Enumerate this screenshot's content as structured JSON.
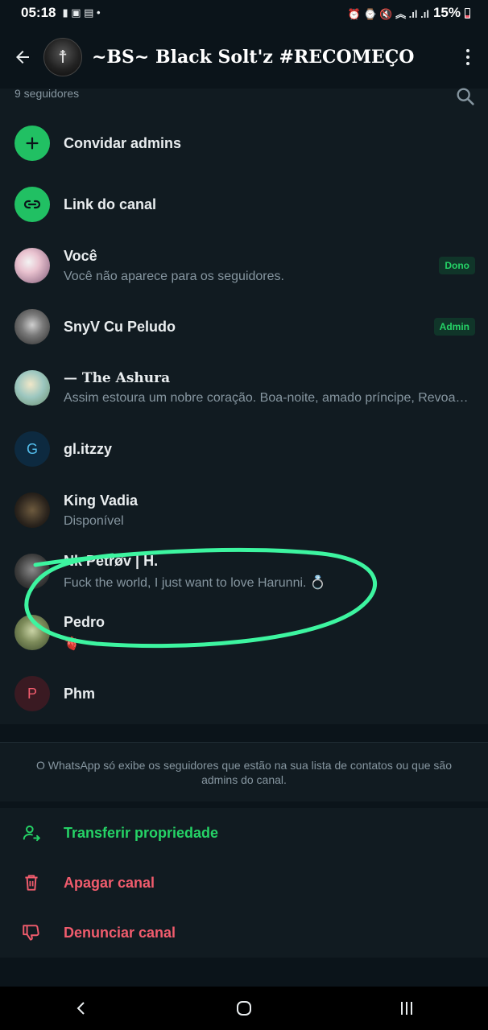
{
  "status_bar": {
    "time": "05:18",
    "battery": "15%"
  },
  "header": {
    "title": "~BS~ Black Solt'z #RECOMEÇO",
    "avatar_glyph": "☨"
  },
  "followers": {
    "count_label": "9 seguidores"
  },
  "actions_top": [
    {
      "label": "Convidar admins",
      "icon": "plus-icon"
    },
    {
      "label": "Link do canal",
      "icon": "link-icon"
    }
  ],
  "members": [
    {
      "name": "Você",
      "status": "Você não aparece para os seguidores.",
      "badge": "Dono",
      "avatar_color": "#c9a7b4"
    },
    {
      "name": "SnyV Cu Peludo",
      "status": "",
      "badge": "Admin",
      "avatar_color": "#8a8a8a"
    },
    {
      "name": "— The Ashura",
      "status": "Assim estoura um nobre coração. Boa-noite, amado príncipe, Revoadas de anjos te embalem o sono.",
      "badge": "",
      "avatar_color": "#c9b88a"
    },
    {
      "name": "gl.itzzy",
      "status": "",
      "badge": "",
      "avatar_letter": "G",
      "avatar_color": "#0d2a40",
      "letter_color": "#53bdeb"
    },
    {
      "name": "King Vadia",
      "status": "Disponível",
      "badge": "",
      "avatar_color": "#3a3026"
    },
    {
      "name": "Nk Petrøv | H.",
      "status": "Fuck the world, I just want to love Harunni. 💍",
      "badge": "",
      "avatar_color": "#4a4a4a"
    },
    {
      "name": "Pedro",
      "status": "🫀",
      "badge": "",
      "avatar_color": "#6b7a4a"
    },
    {
      "name": "Phm",
      "status": "",
      "badge": "",
      "avatar_letter": "P",
      "avatar_color": "#3a1a22",
      "letter_color": "#f15c6d"
    }
  ],
  "footnote": "O WhatsApp só exibe os seguidores que estão na sua lista de contatos ou que são admins do canal.",
  "actions_bottom": [
    {
      "label": "Transferir propriedade",
      "color": "#25d366",
      "icon": "transfer-user-icon"
    },
    {
      "label": "Apagar canal",
      "color": "#f15c6d",
      "icon": "trash-icon"
    },
    {
      "label": "Denunciar canal",
      "color": "#f15c6d",
      "icon": "thumbs-down-icon"
    }
  ],
  "colors": {
    "accent": "#25d366",
    "danger": "#f15c6d",
    "annotation": "#3df5a0"
  }
}
